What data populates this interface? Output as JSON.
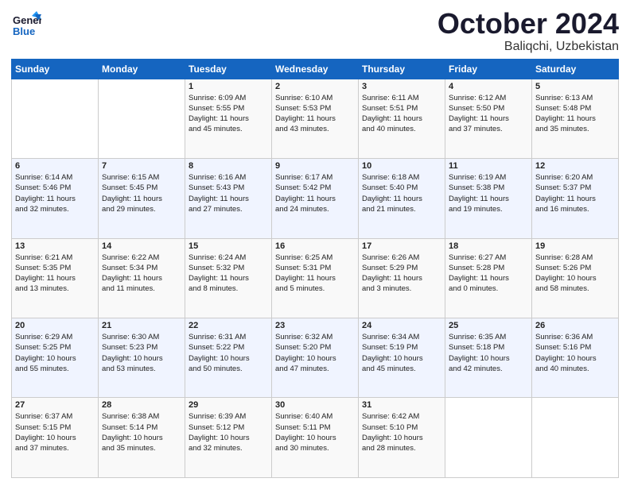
{
  "header": {
    "logo_general": "General",
    "logo_blue": "Blue",
    "title": "October 2024",
    "subtitle": "Baliqchi, Uzbekistan"
  },
  "calendar": {
    "days_of_week": [
      "Sunday",
      "Monday",
      "Tuesday",
      "Wednesday",
      "Thursday",
      "Friday",
      "Saturday"
    ],
    "weeks": [
      [
        {
          "day": "",
          "info": ""
        },
        {
          "day": "",
          "info": ""
        },
        {
          "day": "1",
          "info": "Sunrise: 6:09 AM\nSunset: 5:55 PM\nDaylight: 11 hours\nand 45 minutes."
        },
        {
          "day": "2",
          "info": "Sunrise: 6:10 AM\nSunset: 5:53 PM\nDaylight: 11 hours\nand 43 minutes."
        },
        {
          "day": "3",
          "info": "Sunrise: 6:11 AM\nSunset: 5:51 PM\nDaylight: 11 hours\nand 40 minutes."
        },
        {
          "day": "4",
          "info": "Sunrise: 6:12 AM\nSunset: 5:50 PM\nDaylight: 11 hours\nand 37 minutes."
        },
        {
          "day": "5",
          "info": "Sunrise: 6:13 AM\nSunset: 5:48 PM\nDaylight: 11 hours\nand 35 minutes."
        }
      ],
      [
        {
          "day": "6",
          "info": "Sunrise: 6:14 AM\nSunset: 5:46 PM\nDaylight: 11 hours\nand 32 minutes."
        },
        {
          "day": "7",
          "info": "Sunrise: 6:15 AM\nSunset: 5:45 PM\nDaylight: 11 hours\nand 29 minutes."
        },
        {
          "day": "8",
          "info": "Sunrise: 6:16 AM\nSunset: 5:43 PM\nDaylight: 11 hours\nand 27 minutes."
        },
        {
          "day": "9",
          "info": "Sunrise: 6:17 AM\nSunset: 5:42 PM\nDaylight: 11 hours\nand 24 minutes."
        },
        {
          "day": "10",
          "info": "Sunrise: 6:18 AM\nSunset: 5:40 PM\nDaylight: 11 hours\nand 21 minutes."
        },
        {
          "day": "11",
          "info": "Sunrise: 6:19 AM\nSunset: 5:38 PM\nDaylight: 11 hours\nand 19 minutes."
        },
        {
          "day": "12",
          "info": "Sunrise: 6:20 AM\nSunset: 5:37 PM\nDaylight: 11 hours\nand 16 minutes."
        }
      ],
      [
        {
          "day": "13",
          "info": "Sunrise: 6:21 AM\nSunset: 5:35 PM\nDaylight: 11 hours\nand 13 minutes."
        },
        {
          "day": "14",
          "info": "Sunrise: 6:22 AM\nSunset: 5:34 PM\nDaylight: 11 hours\nand 11 minutes."
        },
        {
          "day": "15",
          "info": "Sunrise: 6:24 AM\nSunset: 5:32 PM\nDaylight: 11 hours\nand 8 minutes."
        },
        {
          "day": "16",
          "info": "Sunrise: 6:25 AM\nSunset: 5:31 PM\nDaylight: 11 hours\nand 5 minutes."
        },
        {
          "day": "17",
          "info": "Sunrise: 6:26 AM\nSunset: 5:29 PM\nDaylight: 11 hours\nand 3 minutes."
        },
        {
          "day": "18",
          "info": "Sunrise: 6:27 AM\nSunset: 5:28 PM\nDaylight: 11 hours\nand 0 minutes."
        },
        {
          "day": "19",
          "info": "Sunrise: 6:28 AM\nSunset: 5:26 PM\nDaylight: 10 hours\nand 58 minutes."
        }
      ],
      [
        {
          "day": "20",
          "info": "Sunrise: 6:29 AM\nSunset: 5:25 PM\nDaylight: 10 hours\nand 55 minutes."
        },
        {
          "day": "21",
          "info": "Sunrise: 6:30 AM\nSunset: 5:23 PM\nDaylight: 10 hours\nand 53 minutes."
        },
        {
          "day": "22",
          "info": "Sunrise: 6:31 AM\nSunset: 5:22 PM\nDaylight: 10 hours\nand 50 minutes."
        },
        {
          "day": "23",
          "info": "Sunrise: 6:32 AM\nSunset: 5:20 PM\nDaylight: 10 hours\nand 47 minutes."
        },
        {
          "day": "24",
          "info": "Sunrise: 6:34 AM\nSunset: 5:19 PM\nDaylight: 10 hours\nand 45 minutes."
        },
        {
          "day": "25",
          "info": "Sunrise: 6:35 AM\nSunset: 5:18 PM\nDaylight: 10 hours\nand 42 minutes."
        },
        {
          "day": "26",
          "info": "Sunrise: 6:36 AM\nSunset: 5:16 PM\nDaylight: 10 hours\nand 40 minutes."
        }
      ],
      [
        {
          "day": "27",
          "info": "Sunrise: 6:37 AM\nSunset: 5:15 PM\nDaylight: 10 hours\nand 37 minutes."
        },
        {
          "day": "28",
          "info": "Sunrise: 6:38 AM\nSunset: 5:14 PM\nDaylight: 10 hours\nand 35 minutes."
        },
        {
          "day": "29",
          "info": "Sunrise: 6:39 AM\nSunset: 5:12 PM\nDaylight: 10 hours\nand 32 minutes."
        },
        {
          "day": "30",
          "info": "Sunrise: 6:40 AM\nSunset: 5:11 PM\nDaylight: 10 hours\nand 30 minutes."
        },
        {
          "day": "31",
          "info": "Sunrise: 6:42 AM\nSunset: 5:10 PM\nDaylight: 10 hours\nand 28 minutes."
        },
        {
          "day": "",
          "info": ""
        },
        {
          "day": "",
          "info": ""
        }
      ]
    ]
  }
}
